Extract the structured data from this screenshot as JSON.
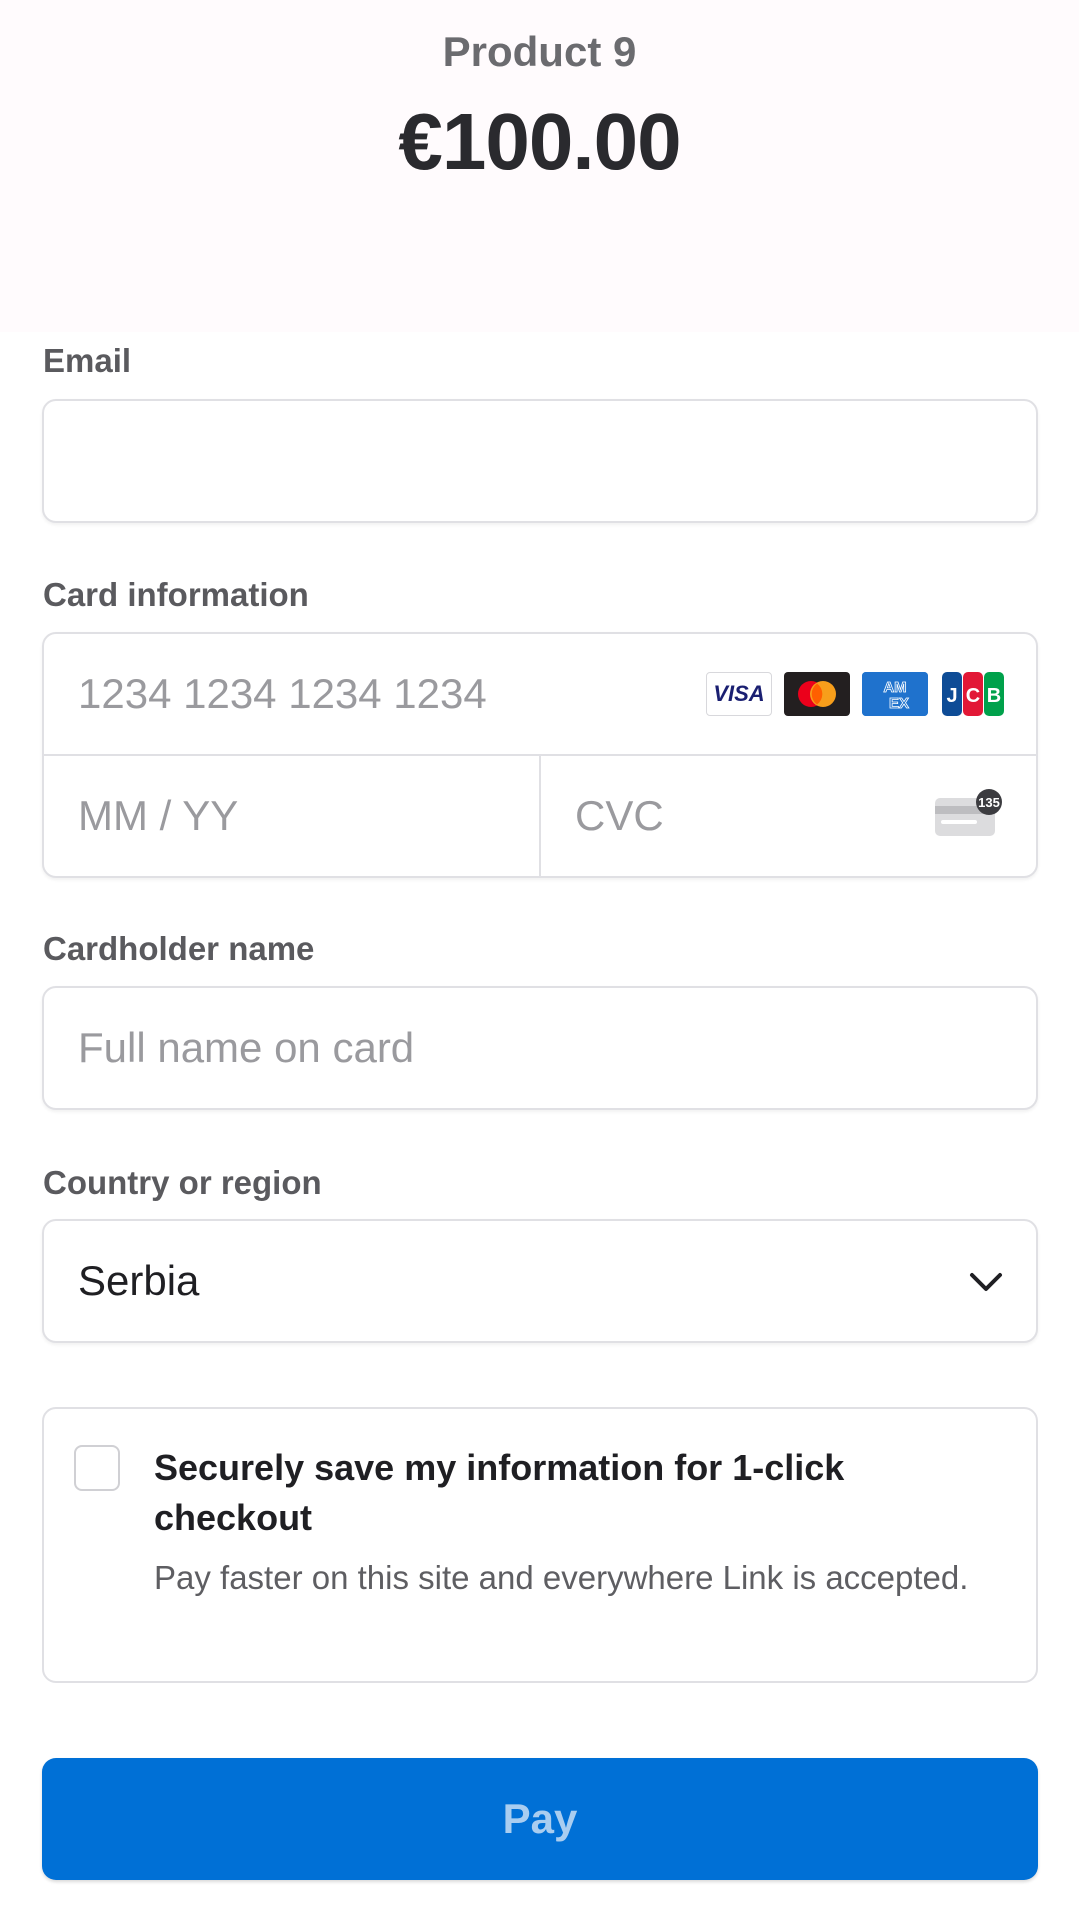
{
  "header": {
    "product_name": "Product 9",
    "price": "€100.00"
  },
  "email": {
    "label": "Email",
    "value": "",
    "placeholder": ""
  },
  "card": {
    "label": "Card information",
    "number_placeholder": "1234 1234 1234 1234",
    "expiry_placeholder": "MM / YY",
    "cvc_placeholder": "CVC",
    "cvc_icon_digits": "135",
    "brands": [
      {
        "name": "visa-icon",
        "text": "VISA",
        "bg": "#ffffff",
        "fg": "#1a1f71"
      },
      {
        "name": "mastercard-icon",
        "text": "",
        "bg": "#231f20",
        "fg": "#ffffff"
      },
      {
        "name": "amex-icon",
        "text": "AM EX",
        "bg": "#1f72cd",
        "fg": "#ffffff"
      },
      {
        "name": "jcb-icon",
        "text": "JCB",
        "bg": "#ffffff",
        "fg": "#ffffff"
      }
    ]
  },
  "cardholder": {
    "label": "Cardholder name",
    "placeholder": "Full name on card"
  },
  "country": {
    "label": "Country or region",
    "selected": "Serbia",
    "icon": "chevron-down-icon"
  },
  "save_info": {
    "checked": false,
    "title": "Securely save my information for 1-click checkout",
    "description": "Pay faster on this site and everywhere Link is accepted."
  },
  "pay": {
    "label": "Pay",
    "color": "#0070d6"
  }
}
